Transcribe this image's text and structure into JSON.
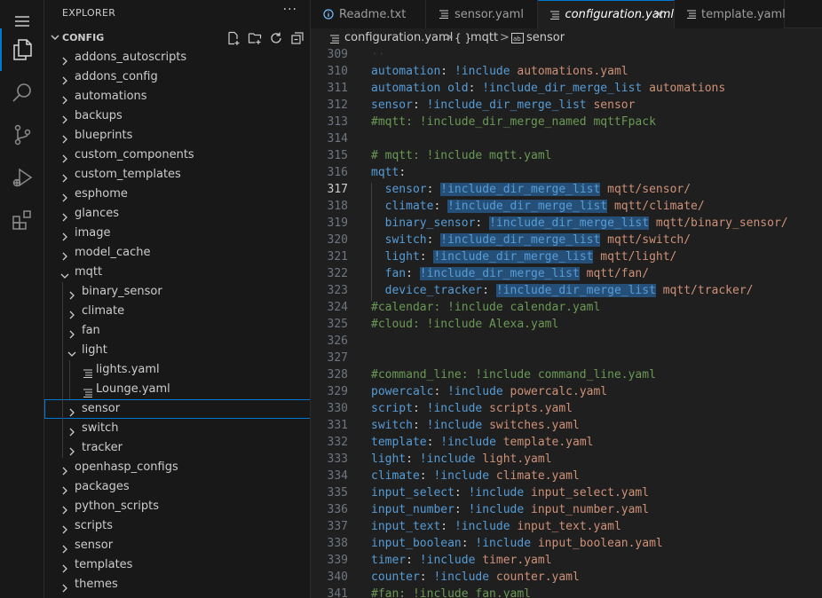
{
  "sidebar": {
    "title": "EXPLORER",
    "more": "···",
    "section": "CONFIG",
    "tree": [
      {
        "label": "addons_autoscripts",
        "depth": 0,
        "type": "folder",
        "open": false
      },
      {
        "label": "addons_config",
        "depth": 0,
        "type": "folder",
        "open": false
      },
      {
        "label": "automations",
        "depth": 0,
        "type": "folder",
        "open": false
      },
      {
        "label": "backups",
        "depth": 0,
        "type": "folder",
        "open": false
      },
      {
        "label": "blueprints",
        "depth": 0,
        "type": "folder",
        "open": false
      },
      {
        "label": "custom_components",
        "depth": 0,
        "type": "folder",
        "open": false
      },
      {
        "label": "custom_templates",
        "depth": 0,
        "type": "folder",
        "open": false
      },
      {
        "label": "esphome",
        "depth": 0,
        "type": "folder",
        "open": false
      },
      {
        "label": "glances",
        "depth": 0,
        "type": "folder",
        "open": false
      },
      {
        "label": "image",
        "depth": 0,
        "type": "folder",
        "open": false
      },
      {
        "label": "model_cache",
        "depth": 0,
        "type": "folder",
        "open": false
      },
      {
        "label": "mqtt",
        "depth": 0,
        "type": "folder",
        "open": true
      },
      {
        "label": "binary_sensor",
        "depth": 1,
        "type": "folder",
        "open": false
      },
      {
        "label": "climate",
        "depth": 1,
        "type": "folder",
        "open": false
      },
      {
        "label": "fan",
        "depth": 1,
        "type": "folder",
        "open": false
      },
      {
        "label": "light",
        "depth": 1,
        "type": "folder",
        "open": true
      },
      {
        "label": "lights.yaml",
        "depth": 2,
        "type": "file"
      },
      {
        "label": "Lounge.yaml",
        "depth": 2,
        "type": "file"
      },
      {
        "label": "sensor",
        "depth": 1,
        "type": "folder",
        "open": false,
        "focused": true
      },
      {
        "label": "switch",
        "depth": 1,
        "type": "folder",
        "open": false
      },
      {
        "label": "tracker",
        "depth": 1,
        "type": "folder",
        "open": false
      },
      {
        "label": "openhasp_configs",
        "depth": 0,
        "type": "folder",
        "open": false
      },
      {
        "label": "packages",
        "depth": 0,
        "type": "folder",
        "open": false
      },
      {
        "label": "python_scripts",
        "depth": 0,
        "type": "folder",
        "open": false
      },
      {
        "label": "scripts",
        "depth": 0,
        "type": "folder",
        "open": false
      },
      {
        "label": "sensor",
        "depth": 0,
        "type": "folder",
        "open": false
      },
      {
        "label": "templates",
        "depth": 0,
        "type": "folder",
        "open": false
      },
      {
        "label": "themes",
        "depth": 0,
        "type": "folder",
        "open": false
      }
    ]
  },
  "tabs": [
    {
      "label": "Readme.txt",
      "icon": "info-icon",
      "active": false
    },
    {
      "label": "sensor.yaml",
      "icon": "lines-icon",
      "active": false
    },
    {
      "label": "configuration.yaml",
      "icon": "lines-icon",
      "active": true
    },
    {
      "label": "template.yaml",
      "icon": "lines-icon",
      "active": false
    }
  ],
  "breadcrumb": {
    "file": "configuration.yaml",
    "sep1": ">",
    "mid_symbol": "{ }",
    "mid": "mqtt",
    "sep2": ">",
    "last": "sensor"
  },
  "editor": {
    "current_line": 317,
    "lines": [
      {
        "n": 309,
        "tokens": [
          {
            "t": "··",
            "c": "ws"
          }
        ]
      },
      {
        "n": 310,
        "tokens": [
          {
            "t": "automation",
            "c": "k"
          },
          {
            "t": ": ",
            "c": "p"
          },
          {
            "t": "!include",
            "c": "t"
          },
          {
            "t": " automations.yaml",
            "c": "s"
          }
        ]
      },
      {
        "n": 311,
        "tokens": [
          {
            "t": "automation old",
            "c": "k"
          },
          {
            "t": ": ",
            "c": "p"
          },
          {
            "t": "!include_dir_merge_list",
            "c": "t"
          },
          {
            "t": " automations",
            "c": "s"
          }
        ]
      },
      {
        "n": 312,
        "tokens": [
          {
            "t": "sensor",
            "c": "k"
          },
          {
            "t": ": ",
            "c": "p"
          },
          {
            "t": "!include_dir_merge_list",
            "c": "t"
          },
          {
            "t": " sensor",
            "c": "s"
          }
        ]
      },
      {
        "n": 313,
        "tokens": [
          {
            "t": "#mqtt: !include_dir_merge_named mqttFpack",
            "c": "c"
          }
        ]
      },
      {
        "n": 314,
        "tokens": []
      },
      {
        "n": 315,
        "tokens": [
          {
            "t": "# mqtt: !include mqtt.yaml",
            "c": "c"
          }
        ]
      },
      {
        "n": 316,
        "tokens": [
          {
            "t": "mqtt",
            "c": "k"
          },
          {
            "t": ":",
            "c": "p"
          }
        ]
      },
      {
        "n": 317,
        "tokens": [
          {
            "t": "  ",
            "c": "p"
          },
          {
            "t": "sensor",
            "c": "k"
          },
          {
            "t": ": ",
            "c": "p"
          },
          {
            "t": "!include_dir_merge_list",
            "c": "t",
            "hl": true
          },
          {
            "t": " mqtt/sensor/",
            "c": "s"
          }
        ]
      },
      {
        "n": 318,
        "tokens": [
          {
            "t": "  ",
            "c": "p"
          },
          {
            "t": "climate",
            "c": "k"
          },
          {
            "t": ": ",
            "c": "p"
          },
          {
            "t": "!include_dir_merge_list",
            "c": "t",
            "hl": true
          },
          {
            "t": " mqtt/climate/",
            "c": "s"
          }
        ]
      },
      {
        "n": 319,
        "tokens": [
          {
            "t": "  ",
            "c": "p"
          },
          {
            "t": "binary_sensor",
            "c": "k"
          },
          {
            "t": ": ",
            "c": "p"
          },
          {
            "t": "!include_dir_merge_list",
            "c": "t",
            "hl": true
          },
          {
            "t": " mqtt/binary_sensor/",
            "c": "s"
          }
        ]
      },
      {
        "n": 320,
        "tokens": [
          {
            "t": "  ",
            "c": "p"
          },
          {
            "t": "switch",
            "c": "k"
          },
          {
            "t": ": ",
            "c": "p"
          },
          {
            "t": "!include_dir_merge_list",
            "c": "t",
            "hl": true
          },
          {
            "t": " mqtt/switch/",
            "c": "s"
          }
        ]
      },
      {
        "n": 321,
        "tokens": [
          {
            "t": "  ",
            "c": "p"
          },
          {
            "t": "light",
            "c": "k"
          },
          {
            "t": ": ",
            "c": "p"
          },
          {
            "t": "!include_dir_merge_list",
            "c": "t",
            "hl": true
          },
          {
            "t": " mqtt/light/",
            "c": "s"
          }
        ]
      },
      {
        "n": 322,
        "tokens": [
          {
            "t": "  ",
            "c": "p"
          },
          {
            "t": "fan",
            "c": "k"
          },
          {
            "t": ": ",
            "c": "p"
          },
          {
            "t": "!include_dir_merge_list",
            "c": "t",
            "hl": true
          },
          {
            "t": " mqtt/fan/",
            "c": "s"
          }
        ]
      },
      {
        "n": 323,
        "tokens": [
          {
            "t": "  ",
            "c": "p"
          },
          {
            "t": "device_tracker",
            "c": "k"
          },
          {
            "t": ": ",
            "c": "p"
          },
          {
            "t": "!include_dir_merge_list",
            "c": "t",
            "hl": true
          },
          {
            "t": " mqtt/tracker/",
            "c": "s"
          }
        ]
      },
      {
        "n": 324,
        "tokens": [
          {
            "t": "#calendar: !include calendar.yaml",
            "c": "c"
          }
        ]
      },
      {
        "n": 325,
        "tokens": [
          {
            "t": "#cloud: !include Alexa.yaml",
            "c": "c"
          }
        ]
      },
      {
        "n": 326,
        "tokens": []
      },
      {
        "n": 327,
        "tokens": []
      },
      {
        "n": 328,
        "tokens": [
          {
            "t": "#command_line: !include command_line.yaml",
            "c": "c"
          }
        ]
      },
      {
        "n": 329,
        "tokens": [
          {
            "t": "powercalc",
            "c": "k"
          },
          {
            "t": ": ",
            "c": "p"
          },
          {
            "t": "!include",
            "c": "t"
          },
          {
            "t": " powercalc.yaml",
            "c": "s"
          }
        ]
      },
      {
        "n": 330,
        "tokens": [
          {
            "t": "script",
            "c": "k"
          },
          {
            "t": ": ",
            "c": "p"
          },
          {
            "t": "!include",
            "c": "t"
          },
          {
            "t": " scripts.yaml",
            "c": "s"
          }
        ]
      },
      {
        "n": 331,
        "tokens": [
          {
            "t": "switch",
            "c": "k"
          },
          {
            "t": ": ",
            "c": "p"
          },
          {
            "t": "!include",
            "c": "t"
          },
          {
            "t": " switches.yaml",
            "c": "s"
          }
        ]
      },
      {
        "n": 332,
        "tokens": [
          {
            "t": "template",
            "c": "k"
          },
          {
            "t": ": ",
            "c": "p"
          },
          {
            "t": "!include",
            "c": "t"
          },
          {
            "t": " template.yaml",
            "c": "s"
          }
        ]
      },
      {
        "n": 333,
        "tokens": [
          {
            "t": "light",
            "c": "k"
          },
          {
            "t": ": ",
            "c": "p"
          },
          {
            "t": "!include",
            "c": "t"
          },
          {
            "t": " light.yaml",
            "c": "s"
          }
        ]
      },
      {
        "n": 334,
        "tokens": [
          {
            "t": "climate",
            "c": "k"
          },
          {
            "t": ": ",
            "c": "p"
          },
          {
            "t": "!include",
            "c": "t"
          },
          {
            "t": " climate.yaml",
            "c": "s"
          }
        ]
      },
      {
        "n": 335,
        "tokens": [
          {
            "t": "input_select",
            "c": "k"
          },
          {
            "t": ": ",
            "c": "p"
          },
          {
            "t": "!include",
            "c": "t"
          },
          {
            "t": " input_select.yaml",
            "c": "s"
          }
        ]
      },
      {
        "n": 336,
        "tokens": [
          {
            "t": "input_number",
            "c": "k"
          },
          {
            "t": ": ",
            "c": "p"
          },
          {
            "t": "!include",
            "c": "t"
          },
          {
            "t": " input_number.yaml",
            "c": "s"
          }
        ]
      },
      {
        "n": 337,
        "tokens": [
          {
            "t": "input_text",
            "c": "k"
          },
          {
            "t": ": ",
            "c": "p"
          },
          {
            "t": "!include",
            "c": "t"
          },
          {
            "t": " input_text.yaml",
            "c": "s"
          }
        ]
      },
      {
        "n": 338,
        "tokens": [
          {
            "t": "input_boolean",
            "c": "k"
          },
          {
            "t": ": ",
            "c": "p"
          },
          {
            "t": "!include",
            "c": "t"
          },
          {
            "t": " input_boolean.yaml",
            "c": "s"
          }
        ]
      },
      {
        "n": 339,
        "tokens": [
          {
            "t": "timer",
            "c": "k"
          },
          {
            "t": ": ",
            "c": "p"
          },
          {
            "t": "!include",
            "c": "t"
          },
          {
            "t": " timer.yaml",
            "c": "s"
          }
        ]
      },
      {
        "n": 340,
        "tokens": [
          {
            "t": "counter",
            "c": "k"
          },
          {
            "t": ": ",
            "c": "p"
          },
          {
            "t": "!include",
            "c": "t"
          },
          {
            "t": " counter.yaml",
            "c": "s"
          }
        ]
      },
      {
        "n": 341,
        "tokens": [
          {
            "t": "#fan: !include fan.yaml",
            "c": "c"
          }
        ]
      }
    ]
  }
}
